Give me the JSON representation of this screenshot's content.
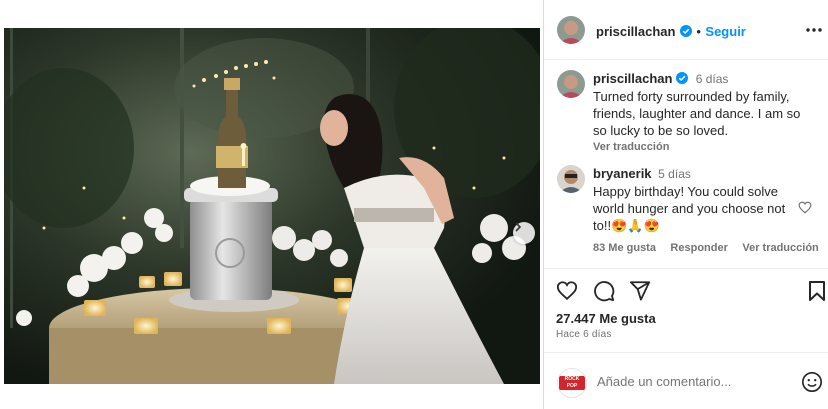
{
  "post": {
    "author": "priscillachan",
    "follow_label": "Seguir",
    "verified_icon": "verified-badge-icon",
    "more_icon": "more-options-icon"
  },
  "caption": {
    "author": "priscillachan",
    "time": "6 días",
    "text": "Turned forty surrounded by family, friends, laughter and dance. I am so so lucky to be so loved.",
    "translate_label": "Ver traducción"
  },
  "comments": [
    {
      "author": "bryanerik",
      "time": "5 días",
      "text": "Happy birthday! You could solve world hunger and you choose not to!!😍🙏😍",
      "likes_label": "83 Me gusta",
      "reply_label": "Responder",
      "translate_label": "Ver traducción"
    }
  ],
  "actions": {
    "like_icon": "heart-icon",
    "comment_icon": "comment-icon",
    "share_icon": "share-icon",
    "save_icon": "bookmark-icon"
  },
  "stats": {
    "likes_label": "27.447 Me gusta",
    "posted_ago": "Hace 6 días"
  },
  "comment_box": {
    "placeholder": "Añade un comentario...",
    "emoji_icon": "emoji-icon",
    "avatar_text": "ROCK POP"
  },
  "carousel": {
    "total": 4,
    "active": 0
  },
  "colors": {
    "link_blue": "#0095f6",
    "muted": "#737373",
    "text": "#262626",
    "verified": "#0095f6"
  }
}
